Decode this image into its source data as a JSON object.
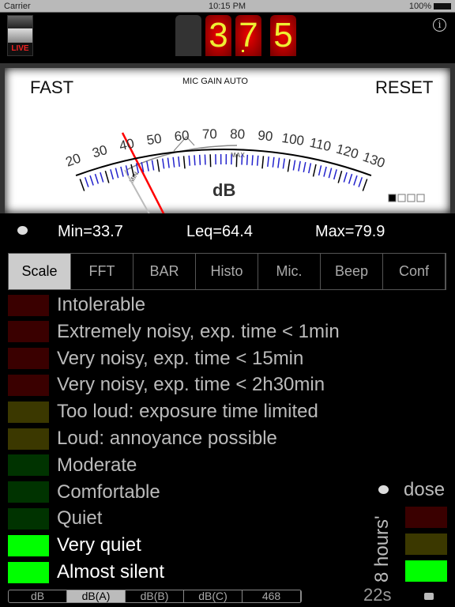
{
  "status": {
    "carrier": "Carrier",
    "time": "10:15 PM",
    "battery": "100%"
  },
  "live": {
    "label": "LIVE"
  },
  "display": {
    "digits": [
      "",
      "3",
      "7",
      "5"
    ],
    "value": 37.5,
    "digit_color": "#eeee33"
  },
  "meter": {
    "mode": "FAST",
    "gain": "MIC GAIN AUTO",
    "reset": "RESET",
    "unit": "dB",
    "scale": [
      20,
      30,
      40,
      50,
      60,
      70,
      80,
      90,
      100,
      110,
      120,
      130
    ],
    "min_label": "MIN",
    "max_label": "MAX",
    "page_dots": 4,
    "page_selected": 1
  },
  "stats": {
    "min": "Min=33.7",
    "leq": "Leq=64.4",
    "max": "Max=79.9"
  },
  "tabs": [
    {
      "label": "Scale",
      "selected": true
    },
    {
      "label": "FFT"
    },
    {
      "label": "BAR"
    },
    {
      "label": "Histo"
    },
    {
      "label": "Mic."
    },
    {
      "label": "Beep"
    },
    {
      "label": "Conf"
    }
  ],
  "scale_rows": [
    {
      "label": "Intolerable",
      "color": "#3a0000"
    },
    {
      "label": "Extremely noisy, exp. time < 1min",
      "color": "#3a0000"
    },
    {
      "label": "Very noisy, exp. time < 15min",
      "color": "#3a0000"
    },
    {
      "label": "Very noisy, exp. time < 2h30min",
      "color": "#3a0000"
    },
    {
      "label": "Too loud: exposure time limited",
      "color": "#3b3800"
    },
    {
      "label": "Loud: annoyance possible",
      "color": "#3b3800"
    },
    {
      "label": "Moderate",
      "color": "#003300"
    },
    {
      "label": "Comfortable",
      "color": "#003300"
    },
    {
      "label": "Quiet",
      "color": "#003300"
    },
    {
      "label": "Very quiet",
      "color": "#00ff00",
      "active": true
    },
    {
      "label": "Almost silent",
      "color": "#00ff00",
      "active": true
    }
  ],
  "dose": {
    "label": "dose",
    "hours": "8 hours'",
    "colors": [
      "#3a0000",
      "#3b3800",
      "#00ff00"
    ],
    "elapsed": "22s"
  },
  "units": [
    {
      "label": "dB"
    },
    {
      "label": "dB(A)",
      "selected": true
    },
    {
      "label": "dB(B)"
    },
    {
      "label": "dB(C)"
    },
    {
      "label": "468"
    }
  ]
}
